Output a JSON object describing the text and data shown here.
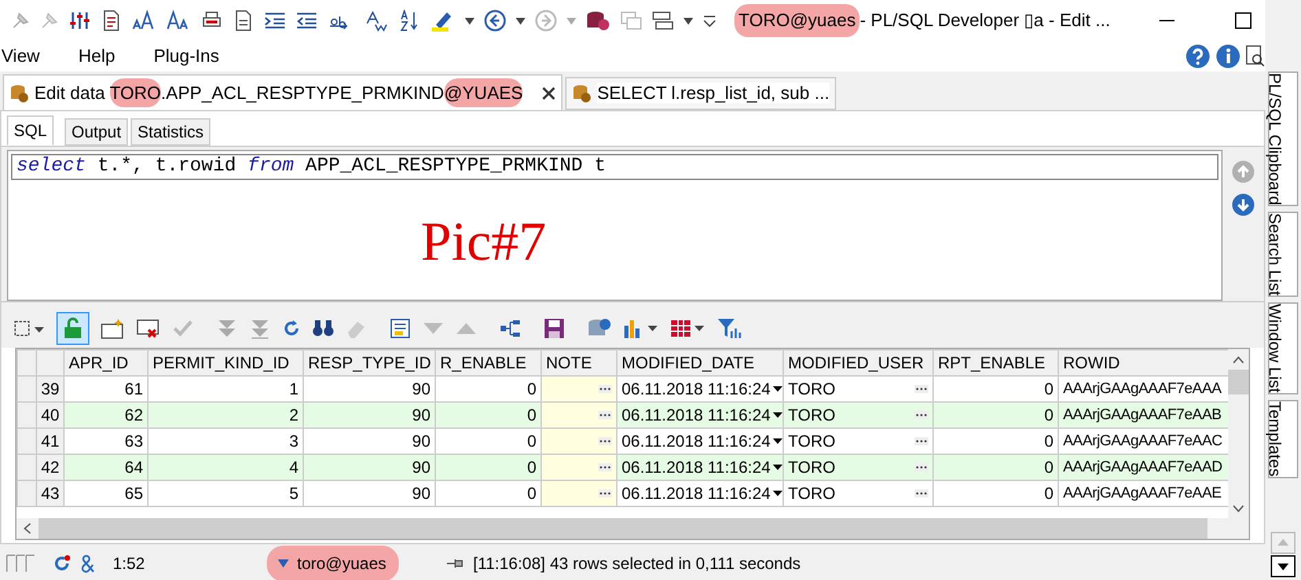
{
  "window": {
    "account": "TORO@yuaes",
    "title": "- PL/SQL Developer ▯a - Edit ..."
  },
  "menu": [
    "View",
    "Help",
    "Plug-Ins"
  ],
  "tabs": [
    {
      "parts": [
        {
          "text": "Edit data ",
          "highlighted": false
        },
        {
          "text": "TORO",
          "highlighted": true
        },
        {
          "text": ".APP_ACL_RESPTYPE_PRMKIND",
          "highlighted": false
        },
        {
          "text": "@YUAES",
          "highlighted": true
        }
      ],
      "selected": true
    },
    {
      "parts": [
        {
          "text": "SELECT l.resp_list_id, sub ...",
          "highlighted": false
        }
      ],
      "selected": false
    }
  ],
  "subtabs": [
    {
      "label": "SQL",
      "selected": true
    },
    {
      "label": "Output",
      "selected": false
    },
    {
      "label": "Statistics",
      "selected": false
    }
  ],
  "editor": {
    "tokens": [
      {
        "text": "select",
        "kind": "keyword"
      },
      {
        "text": " t.*, t.rowid ",
        "kind": "plain"
      },
      {
        "text": "from",
        "kind": "keyword"
      },
      {
        "text": " APP_ACL_RESPTYPE_PRMKIND t",
        "kind": "plain"
      }
    ],
    "annotation": "Pic#7"
  },
  "grid": {
    "columns": [
      "APR_ID",
      "PERMIT_KIND_ID",
      "RESP_TYPE_ID",
      "R_ENABLE",
      "NOTE",
      "MODIFIED_DATE",
      "MODIFIED_USER",
      "RPT_ENABLE",
      "ROWID"
    ],
    "rows": [
      {
        "num": "39",
        "cells": [
          "61",
          "1",
          "90",
          "0",
          "",
          "06.11.2018 11:16:24",
          "TORO",
          "0",
          "AAArjGAAgAAAF7eAAA"
        ]
      },
      {
        "num": "40",
        "cells": [
          "62",
          "2",
          "90",
          "0",
          "",
          "06.11.2018 11:16:24",
          "TORO",
          "0",
          "AAArjGAAgAAAF7eAAB"
        ]
      },
      {
        "num": "41",
        "cells": [
          "63",
          "3",
          "90",
          "0",
          "",
          "06.11.2018 11:16:24",
          "TORO",
          "0",
          "AAArjGAAgAAAF7eAAC"
        ]
      },
      {
        "num": "42",
        "cells": [
          "64",
          "4",
          "90",
          "0",
          "",
          "06.11.2018 11:16:24",
          "TORO",
          "0",
          "AAArjGAAgAAAF7eAAD"
        ]
      },
      {
        "num": "43",
        "cells": [
          "65",
          "5",
          "90",
          "0",
          "",
          "06.11.2018 11:16:24",
          "TORO",
          "0",
          "AAArjGAAgAAAF7eAAE"
        ]
      }
    ]
  },
  "side_tabs": [
    "PL/SQL Clipboard",
    "Search List",
    "Window List",
    "Templates"
  ],
  "status_bar": {
    "position": "1:52",
    "connection": "toro@yuaes",
    "message": "[11:16:08] 43 rows selected in 0,111 seconds"
  }
}
